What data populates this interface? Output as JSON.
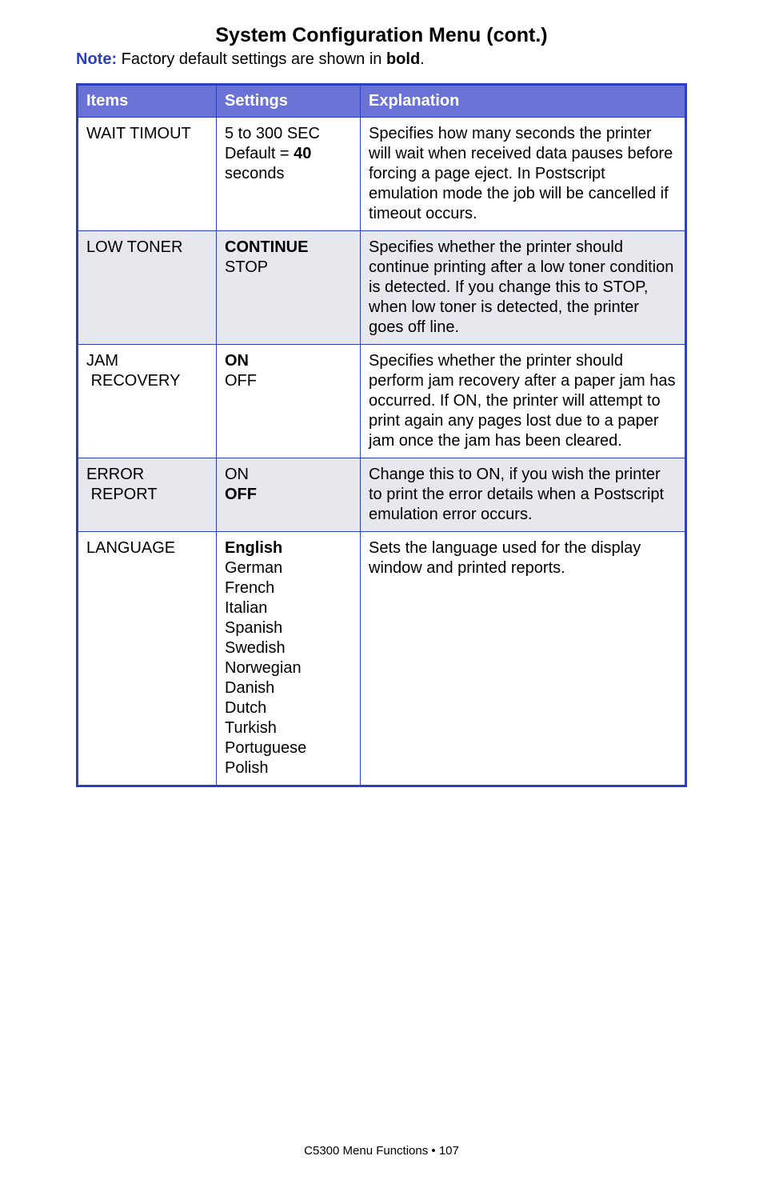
{
  "title": "System Configuration Menu (cont.)",
  "note_label": "Note:",
  "note_prefix": " Factory default settings are shown in ",
  "note_bold": "bold",
  "note_suffix": ".",
  "headers": {
    "items": "Items",
    "settings": "Settings",
    "explanation": "Explanation"
  },
  "rows": [
    {
      "item": "WAIT TIMOUT",
      "settings_pre": "5 to 300 SEC\nDefault = ",
      "settings_bold": "40",
      "settings_post": "\nseconds",
      "explanation": "Specifies how many seconds the printer will wait when received data pauses before forcing a page eject. In Postscript emulation  mode the job will be cancelled if timeout occurs.",
      "shaded": false
    },
    {
      "item": "LOW TONER",
      "settings_bold": "CONTINUE",
      "settings_post": "\nSTOP",
      "explanation": "Specifies whether the printer should continue printing after a low toner condition is detected. If you change this to STOP, when low toner is detected, the printer goes off line.",
      "shaded": true
    },
    {
      "item": "JAM\n RECOVERY",
      "settings_bold": "ON",
      "settings_post": "\nOFF",
      "explanation": "Specifies whether the printer should perform jam recovery after a paper jam has occurred. If ON, the printer will attempt to print again any pages lost due to a paper jam once the jam has been cleared.",
      "shaded": false
    },
    {
      "item": "ERROR\n REPORT",
      "settings_pre": "ON\n",
      "settings_bold": "OFF",
      "explanation": "Change this to ON, if you wish the printer to print the error details when a Postscript emulation error occurs.",
      "shaded": true
    },
    {
      "item": "LANGUAGE",
      "settings_bold": "English",
      "settings_post": "\nGerman\nFrench\nItalian\nSpanish\nSwedish\nNorwegian\nDanish\nDutch\nTurkish\nPortuguese\nPolish",
      "explanation": "Sets the language used for the display window and printed reports.",
      "shaded": false
    }
  ],
  "footer": "C5300 Menu Functions  • 107"
}
